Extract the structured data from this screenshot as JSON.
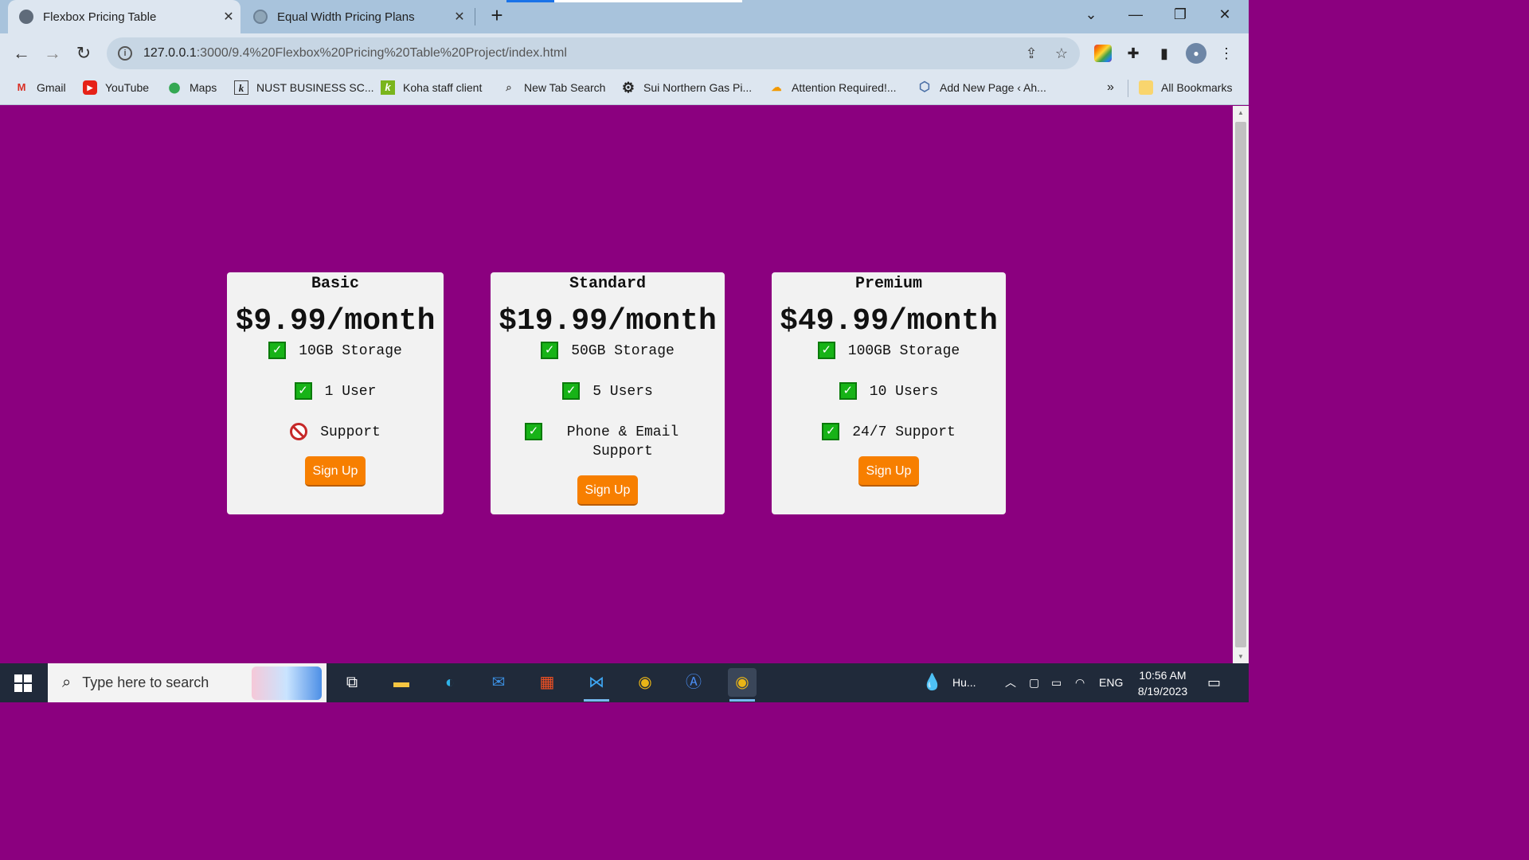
{
  "browser": {
    "tabs": [
      {
        "title": "Flexbox Pricing Table",
        "active": true
      },
      {
        "title": "Equal Width Pricing Plans",
        "active": false
      }
    ],
    "url_host": "127.0.0.1",
    "url_rest": ":3000/9.4%20Flexbox%20Pricing%20Table%20Project/index.html",
    "bookmarks": [
      {
        "label": "Gmail",
        "icon": "gmail-icon"
      },
      {
        "label": "YouTube",
        "icon": "youtube-icon"
      },
      {
        "label": "Maps",
        "icon": "maps-icon"
      },
      {
        "label": "NUST BUSINESS SC...",
        "icon": "k-icon"
      },
      {
        "label": "Koha staff client",
        "icon": "koha-icon"
      },
      {
        "label": "New Tab Search",
        "icon": "search-icon"
      },
      {
        "label": "Sui Northern Gas Pi...",
        "icon": "gear-icon"
      },
      {
        "label": "Attention Required!...",
        "icon": "cloud-icon"
      },
      {
        "label": "Add New Page ‹ Ah...",
        "icon": "hexagon-icon"
      }
    ],
    "all_bookmarks": "All Bookmarks",
    "overflow": "»"
  },
  "pricing": [
    {
      "name": "Basic",
      "price": "$9.99/month",
      "features": [
        {
          "text": "10GB Storage",
          "included": true
        },
        {
          "text": "1 User",
          "included": true
        },
        {
          "text": "Support",
          "included": false
        }
      ],
      "cta": "Sign Up"
    },
    {
      "name": "Standard",
      "price": "$19.99/month",
      "features": [
        {
          "text": "50GB Storage",
          "included": true
        },
        {
          "text": "5 Users",
          "included": true
        },
        {
          "text": "Phone & Email Support",
          "included": true
        }
      ],
      "cta": "Sign Up"
    },
    {
      "name": "Premium",
      "price": "$49.99/month",
      "features": [
        {
          "text": "100GB Storage",
          "included": true
        },
        {
          "text": "10 Users",
          "included": true
        },
        {
          "text": "24/7 Support",
          "included": true
        }
      ],
      "cta": "Sign Up"
    }
  ],
  "colors": {
    "page_bg": "#8b007f",
    "card_bg": "#f2f2f2",
    "button": "#f77f00",
    "check": "#17b317"
  },
  "taskbar": {
    "search_placeholder": "Type here to search",
    "weather": "Hu...",
    "language": "ENG",
    "time": "10:56 AM",
    "date": "8/19/2023"
  }
}
